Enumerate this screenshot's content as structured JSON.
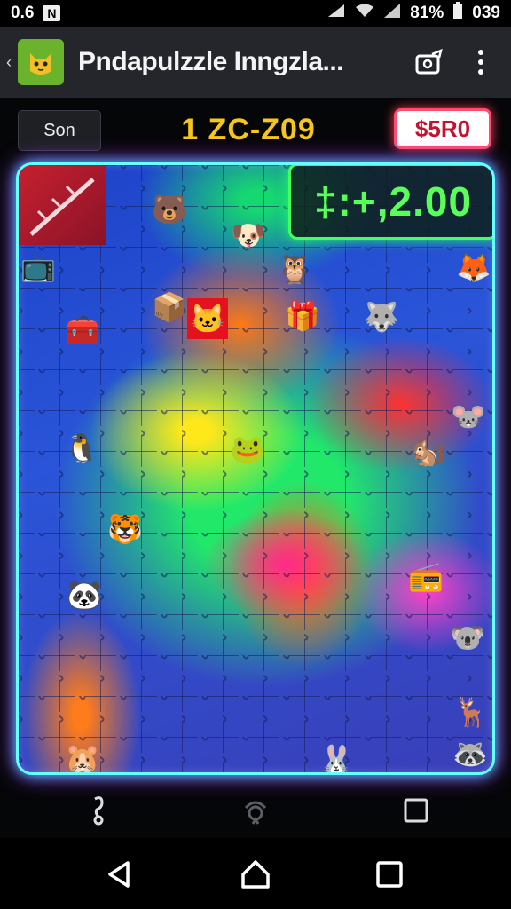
{
  "status_bar": {
    "time": "0.6",
    "battery": "81%",
    "clock": "039"
  },
  "app_bar": {
    "title": "Pndapulzzle Inngzla..."
  },
  "game": {
    "son_label": "Son",
    "timer": "1 ZC-Z09",
    "price_label": "$5R0",
    "score": "‡:+,2.00"
  },
  "icons": {
    "back": "chevron-left-icon",
    "app": "cat-app-icon",
    "share": "share-icon",
    "more": "more-vert-icon",
    "hint": "hint-icon",
    "rotate": "rotate-icon",
    "stop": "square-icon",
    "nav_back": "triangle-back-icon",
    "nav_home": "home-icon",
    "nav_recent": "recent-apps-icon"
  },
  "colors": {
    "board_glow": "#66ffff",
    "score_green": "#58ff5a",
    "timer_yellow": "#f7c51c",
    "price_red": "#c41230"
  }
}
